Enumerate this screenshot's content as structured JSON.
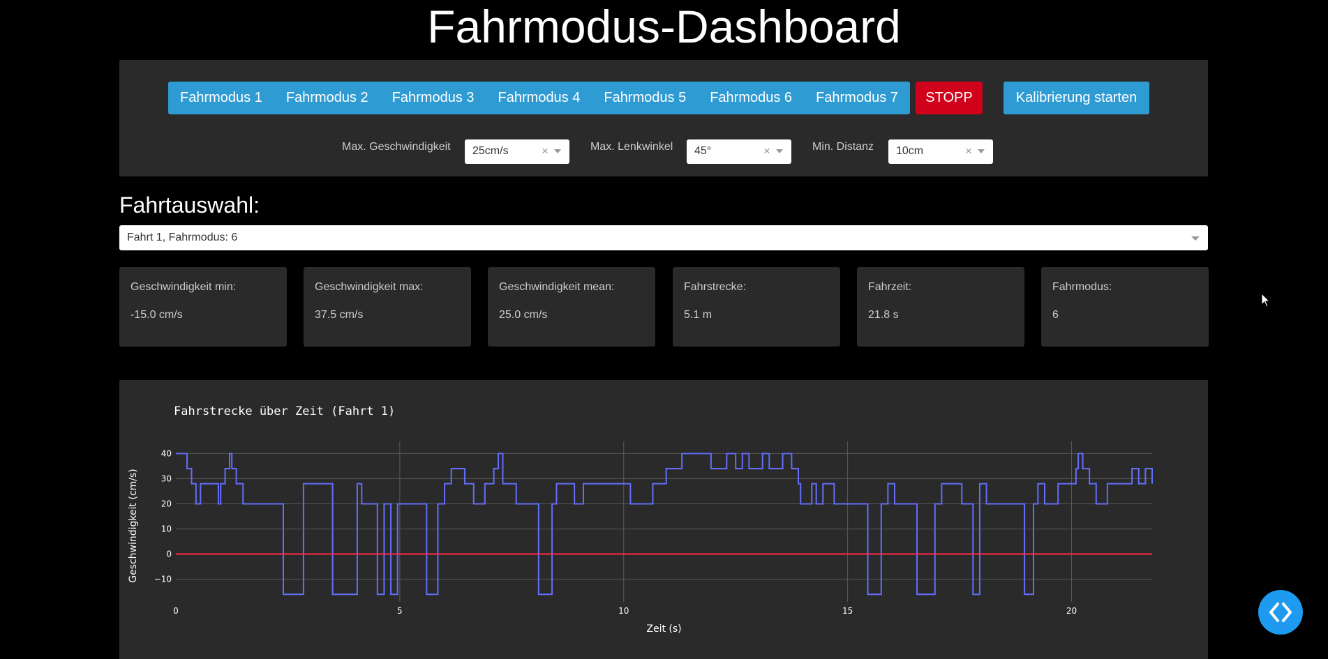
{
  "header": {
    "title": "Fahrmodus-Dashboard"
  },
  "controls": {
    "modes": [
      "Fahrmodus 1",
      "Fahrmodus 2",
      "Fahrmodus 3",
      "Fahrmodus 4",
      "Fahrmodus 5",
      "Fahrmodus 6",
      "Fahrmodus 7"
    ],
    "stop_label": "STOPP",
    "calibrate_label": "Kalibrierung starten",
    "speed": {
      "label": "Max. Geschwindigkeit",
      "value": "25cm/s"
    },
    "steering": {
      "label": "Max. Lenkwinkel",
      "value": "45°"
    },
    "distance": {
      "label": "Min. Distanz",
      "value": "10cm"
    },
    "clear_glyph": "×"
  },
  "ride": {
    "heading": "Fahrtauswahl:",
    "selected": "Fahrt 1, Fahrmodus: 6"
  },
  "stats": [
    {
      "label": "Geschwindigkeit min:",
      "value": "-15.0 cm/s"
    },
    {
      "label": "Geschwindigkeit max:",
      "value": "37.5 cm/s"
    },
    {
      "label": "Geschwindigkeit mean:",
      "value": "25.0 cm/s"
    },
    {
      "label": "Fahrstrecke:",
      "value": "5.1 m"
    },
    {
      "label": "Fahrzeit:",
      "value": "21.8 s"
    },
    {
      "label": "Fahrmodus:",
      "value": "6"
    }
  ],
  "colors": {
    "accent": "#2f9bd3",
    "stop": "#d0021b",
    "line": "#636efa",
    "zero_line": "#ff2a4a",
    "panel": "#2a2a2a",
    "fab": "#1e9bf0"
  },
  "icons": {
    "cursor": "mouse-pointer-icon",
    "fab": "code-brackets-icon",
    "clear": "clear-icon",
    "dropdown": "chevron-down-icon"
  },
  "chart_data": {
    "type": "line",
    "line_shape": "step",
    "title": "Fahrstrecke über Zeit (Fahrt 1)",
    "xlabel": "Zeit (s)",
    "ylabel": "Geschwindigkeit (cm/s)",
    "xlim": [
      0,
      21.8
    ],
    "ylim": [
      -19,
      41.5
    ],
    "xticks": [
      0,
      5,
      10,
      15,
      20
    ],
    "yticks": [
      -10,
      0,
      10,
      20,
      30,
      40
    ],
    "grid": true,
    "reference_line": {
      "y": 0,
      "color": "#ff2a4a"
    },
    "series": [
      {
        "x": [
          0,
          0.25,
          0.35,
          0.45,
          0.55,
          0.95,
          1.0,
          1.1,
          1.2,
          1.25,
          1.35,
          1.5,
          2.4,
          2.85,
          3.5,
          4.05,
          4.15,
          4.25,
          4.5,
          4.65,
          4.8,
          4.95,
          5.6,
          5.85,
          6.0,
          6.15,
          6.45,
          6.65,
          6.9,
          7.1,
          7.2,
          7.3,
          7.6,
          8.1,
          8.4,
          8.5,
          8.9,
          9.1,
          10.15,
          10.65,
          10.95,
          11.3,
          11.7,
          11.95,
          12.3,
          12.5,
          12.65,
          12.8,
          13.1,
          13.25,
          13.55,
          13.75,
          13.9,
          13.95,
          14.2,
          14.3,
          14.45,
          14.7,
          14.9,
          15.0,
          15.45,
          15.75,
          15.9,
          16.05,
          16.55,
          16.95,
          17.1,
          17.55,
          17.8,
          17.95,
          18.1,
          18.95,
          19.15,
          19.25,
          19.4,
          19.7,
          20.1,
          20.15,
          20.25,
          20.4,
          20.55,
          20.8,
          21.35,
          21.5,
          21.65,
          21.8
        ],
        "y": [
          40,
          34,
          28,
          20,
          28,
          20,
          28,
          34,
          40,
          34,
          28,
          20,
          -16,
          28,
          -16,
          28,
          20,
          20,
          -16,
          20,
          -16,
          20,
          -16,
          20,
          28,
          34,
          28,
          20,
          28,
          34,
          40,
          28,
          20,
          -16,
          20,
          28,
          20,
          28,
          20,
          28,
          34,
          40,
          40,
          34,
          40,
          34,
          40,
          34,
          40,
          34,
          40,
          34,
          28,
          20,
          28,
          20,
          28,
          20,
          20,
          20,
          -16,
          20,
          28,
          20,
          -16,
          20,
          28,
          20,
          -16,
          28,
          20,
          -16,
          20,
          28,
          20,
          28,
          34,
          40,
          34,
          28,
          20,
          28,
          34,
          28,
          34,
          28
        ]
      }
    ]
  }
}
